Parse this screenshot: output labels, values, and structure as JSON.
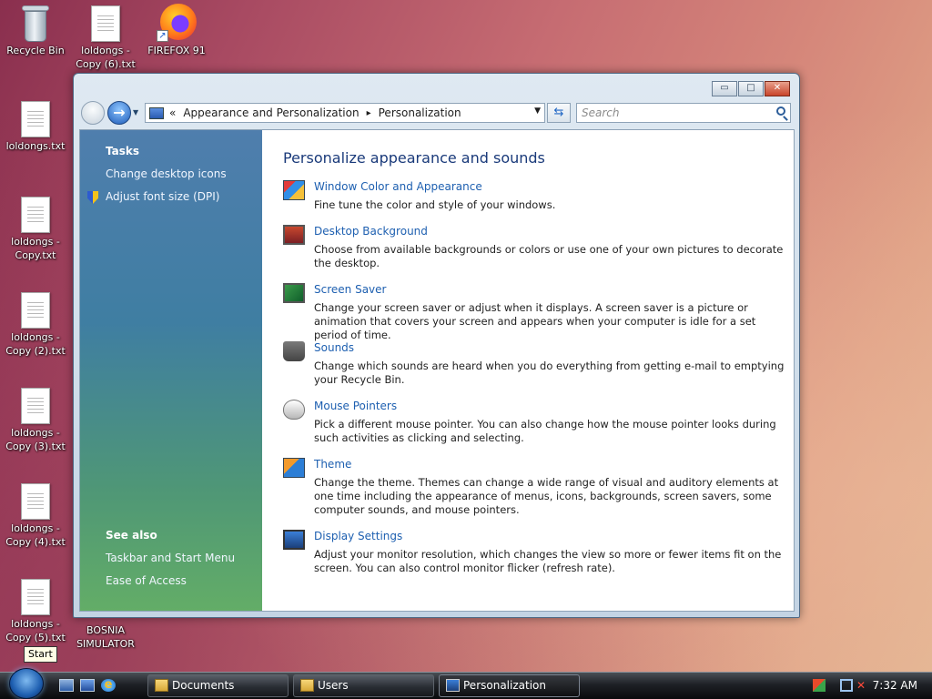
{
  "desktop": {
    "icons": [
      {
        "label": "Recycle Bin"
      },
      {
        "label": "loldongs - Copy (6).txt"
      },
      {
        "label": "FIREFOX 91"
      },
      {
        "label": "loldongs.txt"
      },
      {
        "label": "loldongs - Copy.txt"
      },
      {
        "label": "loldongs - Copy (2).txt"
      },
      {
        "label": "loldongs - Copy (3).txt"
      },
      {
        "label": "loldongs - Copy (4).txt"
      },
      {
        "label": "loldongs - Copy (5).txt"
      },
      {
        "label": "BOSNIA SIMULATOR"
      }
    ]
  },
  "window": {
    "controls": {
      "minimize": "▭",
      "maximize": "□",
      "close": "✕"
    },
    "address": {
      "prefix": "«",
      "crumb1": "Appearance and Personalization",
      "separator": "▸",
      "crumb2": "Personalization"
    },
    "search_placeholder": "Search",
    "sidebar": {
      "tasks_heading": "Tasks",
      "tasks": [
        "Change desktop icons",
        "Adjust font size (DPI)"
      ],
      "see_also_heading": "See also",
      "see_also": [
        "Taskbar and Start Menu",
        "Ease of Access"
      ]
    },
    "main": {
      "heading": "Personalize appearance and sounds",
      "items": [
        {
          "title": "Window Color and Appearance",
          "desc": "Fine tune the color and style of your windows."
        },
        {
          "title": "Desktop Background",
          "desc": "Choose from available backgrounds or colors or use one of your own pictures to decorate the desktop."
        },
        {
          "title": "Screen Saver",
          "desc": "Change your screen saver or adjust when it displays. A screen saver is a picture or animation that covers your screen and appears when your computer is idle for a set period of time."
        },
        {
          "title": "Sounds",
          "desc": "Change which sounds are heard when you do everything from getting e-mail to emptying your Recycle Bin."
        },
        {
          "title": "Mouse Pointers",
          "desc": "Pick a different mouse pointer. You can also change how the mouse pointer looks during such activities as clicking and selecting."
        },
        {
          "title": "Theme",
          "desc": "Change the theme. Themes can change a wide range of visual and auditory elements at one time including the appearance of menus, icons, backgrounds, screen savers, some computer sounds, and mouse pointers."
        },
        {
          "title": "Display Settings",
          "desc": "Adjust your monitor resolution, which changes the view so more or fewer items fit on the screen. You can also control monitor flicker (refresh rate)."
        }
      ]
    }
  },
  "taskbar": {
    "start_tooltip": "Start",
    "buttons": [
      {
        "label": "Documents"
      },
      {
        "label": "Users"
      },
      {
        "label": "Personalization"
      }
    ],
    "clock": "7:32 AM"
  }
}
